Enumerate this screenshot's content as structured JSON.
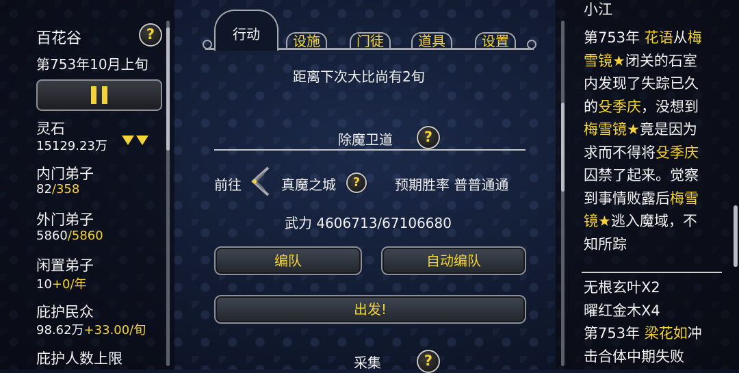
{
  "left": {
    "sect_name": "百花谷",
    "date": "第753年10月上旬",
    "stones_label": "灵石",
    "stones_value": "15129.23万",
    "inner_label": "内门弟子",
    "inner_cur": "82",
    "inner_max": "/358",
    "outer_label": "外门弟子",
    "outer_cur": "5860",
    "outer_max": "/5860",
    "idle_label": "闲置弟子",
    "idle_cur": "10",
    "idle_rate": "+0/年",
    "people_label": "庇护民众",
    "people_cur": "98.62万",
    "people_rate": "+33.00/旬",
    "limit_label": "庇护人数上限"
  },
  "tabs": {
    "active": "行动",
    "items": [
      "设施",
      "门徒",
      "道具",
      "设置"
    ]
  },
  "main": {
    "next_contest": "距离下次大比尚有2旬",
    "section_title": "除魔卫道",
    "goto": "前往",
    "destination": "真魔之城",
    "win_rate": "预期胜率 普普通通",
    "force": "武力 4606713/67106680",
    "team_button": "编队",
    "auto_team_button": "自动编队",
    "depart_button": "出发!",
    "next_section": "采集"
  },
  "help_glyph": "?",
  "right": {
    "name": "小江",
    "log1_lines": [
      [
        {
          "t": "第753年 ",
          "c": "w"
        },
        {
          "t": "花语",
          "c": "y"
        },
        {
          "t": "从",
          "c": "w"
        },
        {
          "t": "梅",
          "c": "y"
        }
      ],
      [
        {
          "t": "雪镜★",
          "c": "y"
        },
        {
          "t": "闭关的石室",
          "c": "w"
        }
      ],
      [
        {
          "t": "内发现了失踪已久",
          "c": "w"
        }
      ],
      [
        {
          "t": "的",
          "c": "w"
        },
        {
          "t": "殳季庆",
          "c": "y"
        },
        {
          "t": "，没想到",
          "c": "w"
        }
      ],
      [
        {
          "t": "梅雪镜★",
          "c": "y"
        },
        {
          "t": "竟是因为",
          "c": "w"
        }
      ],
      [
        {
          "t": "求而不得将",
          "c": "w"
        },
        {
          "t": "殳季庆",
          "c": "y"
        }
      ],
      [
        {
          "t": "囚禁了起来。觉察",
          "c": "w"
        }
      ],
      [
        {
          "t": "到事情败露后",
          "c": "w"
        },
        {
          "t": "梅雪",
          "c": "y"
        }
      ],
      [
        {
          "t": "镜★",
          "c": "y"
        },
        {
          "t": "逃入魔域，不",
          "c": "w"
        }
      ],
      [
        {
          "t": "知所踪",
          "c": "w"
        }
      ]
    ],
    "log2_lines": [
      [
        {
          "t": "无根玄叶X2",
          "c": "w"
        }
      ],
      [
        {
          "t": "曜红金木X4",
          "c": "w"
        }
      ],
      [
        {
          "t": "第753年 ",
          "c": "w"
        },
        {
          "t": "梁花如",
          "c": "y"
        },
        {
          "t": "冲",
          "c": "w"
        }
      ],
      [
        {
          "t": "击合体中期失败",
          "c": "w"
        }
      ]
    ]
  },
  "colors": {
    "accent": "#f3d23a",
    "text": "#f2f2f2",
    "bg": "#111a30"
  }
}
